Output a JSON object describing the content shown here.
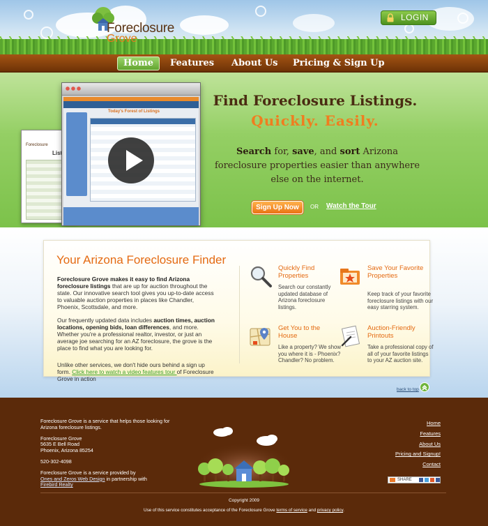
{
  "colors": {
    "brand_brown": "#5b2a0a",
    "brand_orange": "#e46a12",
    "brand_green": "#6fb43b",
    "nav_brown": "#8a440d"
  },
  "header": {
    "logo_line1": "Foreclosure",
    "logo_line2": "Grove",
    "login_label": "LOGIN",
    "login_icon": "lock-icon"
  },
  "nav": {
    "items": [
      {
        "label": "Home",
        "active": true
      },
      {
        "label": "Features"
      },
      {
        "label": "About Us"
      },
      {
        "label": "Pricing & Sign Up"
      }
    ]
  },
  "hero": {
    "headline": "Find Foreclosure Listings.",
    "tagline": "Quickly. Easily.",
    "sub_bold1": "Search",
    "sub_t1": " for, ",
    "sub_bold2": "save",
    "sub_t2": ", and ",
    "sub_bold3": "sort",
    "sub_t3": " Arizona foreclosure properties easier than anywhere else on the internet.",
    "signup_label": "Sign Up Now",
    "or_label": "OR",
    "tour_label": "Watch the Tour",
    "screenshot_title": "Today's Forest of Listings",
    "back_screenshot_logo": "Foreclosure",
    "back_screenshot_label": "Listi",
    "play_icon": "play-icon"
  },
  "finder": {
    "title": "Your Arizona Foreclosure Finder",
    "p1_bold": "Foreclosure Grove makes it easy to find Arizona foreclosure listings",
    "p1_rest": " that are up for auction throughout the state. Our innovative search tool gives you up-to-date access to valuable auction properties in places like Chandler, Phoenix, Scottsdale, and more.",
    "p2_a": "Our frequently updated data includes ",
    "p2_b1": "auction times, auction locations, opening bids, loan differences",
    "p2_b": ", and more. Whether you're a professional realtor, investor, or just an average joe searching for an AZ foreclosure, the grove is the place to find what you are looking for.",
    "p3_a": "Unlike other services, we don't hide ours behind a sign up form. ",
    "p3_link": "Click here to watch a video features tour ",
    "p3_b": "of Foreclosure Grove in action",
    "features": [
      {
        "title": "Quickly Find Properties",
        "text": "Search our constantly updated database of Arizona foreclosure listings.",
        "icon": "magnifier-icon"
      },
      {
        "title": "Save Your Favorite Properties",
        "text": "Keep track of your favorite foreclosure listings with our easy starring system.",
        "icon": "folder-star-icon"
      },
      {
        "title": "Get You to the House",
        "text": "Like a property? We show you where it is - Phoenix? Chandler? No problem.",
        "icon": "map-icon"
      },
      {
        "title": "Auction-Friendly Printouts",
        "text": "Take a professional copy of all of your favorite listings to your AZ auction site.",
        "icon": "printout-icon"
      }
    ],
    "back_to_top": "back to top",
    "back_to_top_icon": "up-arrow-icon"
  },
  "footer": {
    "about": "Foreclosure Grove is a service that helps those looking for Arizona foreclosure listings.",
    "name": "Foreclosure Grove",
    "addr1": "5635 E Bell Road",
    "addr2": "Phoenix, Arizona 85254",
    "phone": "520-302-4098",
    "provided_a": "Foreclosure Grove is a service provided by",
    "provided_link1": "Ones and Zeros Web Design",
    "provided_b": " in partnership with",
    "provided_link2": "Firebird Realty",
    "links": [
      "Home",
      "Features",
      "About Us",
      "Pricing and Signup!",
      "Contact"
    ],
    "share_label": "SHARE",
    "copyright": "Copyright 2009",
    "terms_a": "Use of this service constitutes acceptance of the Foreclosure Grove ",
    "terms_link1": "terms of service",
    "terms_and": " and ",
    "terms_link2": "privacy policy",
    "terms_end": "."
  }
}
